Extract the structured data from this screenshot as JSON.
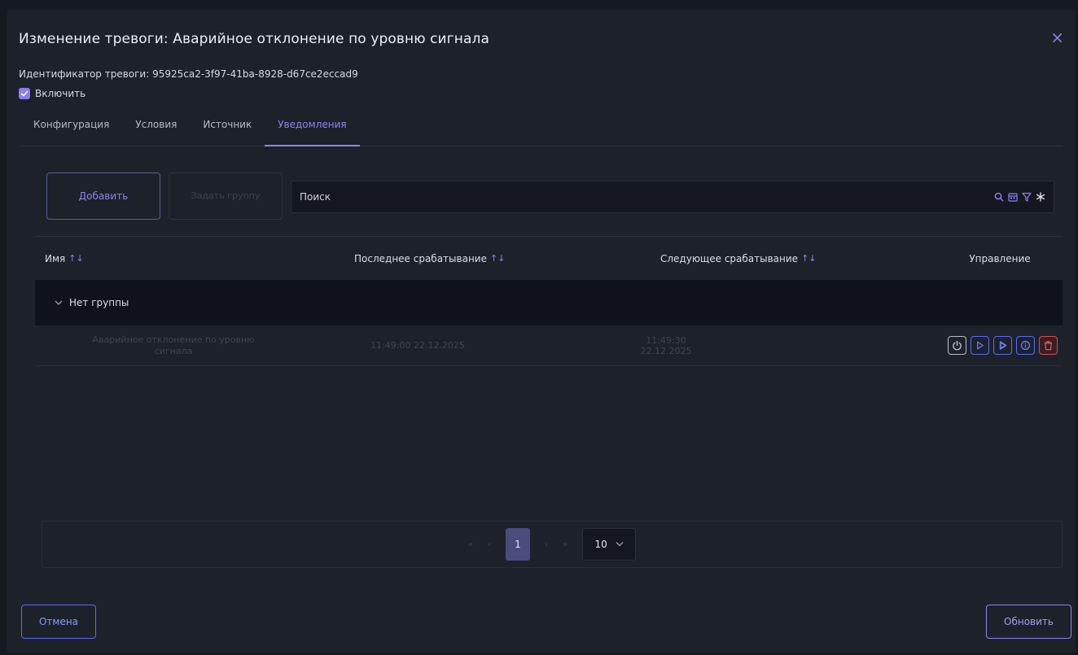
{
  "dialog": {
    "title": "Изменение тревоги: Аварийное отклонение по уровню сигнала",
    "close_label": "×",
    "identifier_label": "Идентификатор тревоги: 95925ca2-3f97-41ba-8928-d67ce2eccad9",
    "enable_label": "Включить",
    "enable_checked": true
  },
  "tabs": [
    {
      "label": "Конфигурация",
      "active": false
    },
    {
      "label": "Условия",
      "active": false
    },
    {
      "label": "Источник",
      "active": false
    },
    {
      "label": "Уведомления",
      "active": true
    }
  ],
  "toolbar": {
    "add_label": "Добавить",
    "set_group_label": "Задать группу",
    "search_placeholder": "Поиск",
    "icons": [
      "search-icon",
      "calendar-icon",
      "filter-icon",
      "asterisk-icon"
    ]
  },
  "table": {
    "columns": [
      {
        "label": "Имя",
        "sort": "↑↓"
      },
      {
        "label": "Последнее срабатывание",
        "sort": "↑↓"
      },
      {
        "label": "Следующее срабатывание",
        "sort": "↑↓"
      },
      {
        "label": "Управление"
      }
    ],
    "groups": [
      {
        "label": "Нет группы",
        "expand_icon": "chevron-down-icon",
        "rows": [
          {
            "name": "Аварийное отклонение по уровню сигнала",
            "last_triggered": "11:49:00 22.12.2025",
            "next_triggered": "11:49:30 22.12.2025",
            "actions": [
              "power-icon",
              "play-icon",
              "play-outline-icon",
              "info-icon",
              "trash-icon"
            ]
          }
        ]
      }
    ]
  },
  "pagination": {
    "first": "«",
    "prev": "‹",
    "current_page": "1",
    "next": "›",
    "last": "»",
    "page_size": "10",
    "dropdown": "⌄"
  },
  "footer": {
    "cancel_label": "Отмена",
    "update_label": "Обновить"
  },
  "colors": {
    "accent": "#8f83f2",
    "blue_action": "#5b6bff",
    "danger": "#d64b4b",
    "background": "#1d2129"
  }
}
